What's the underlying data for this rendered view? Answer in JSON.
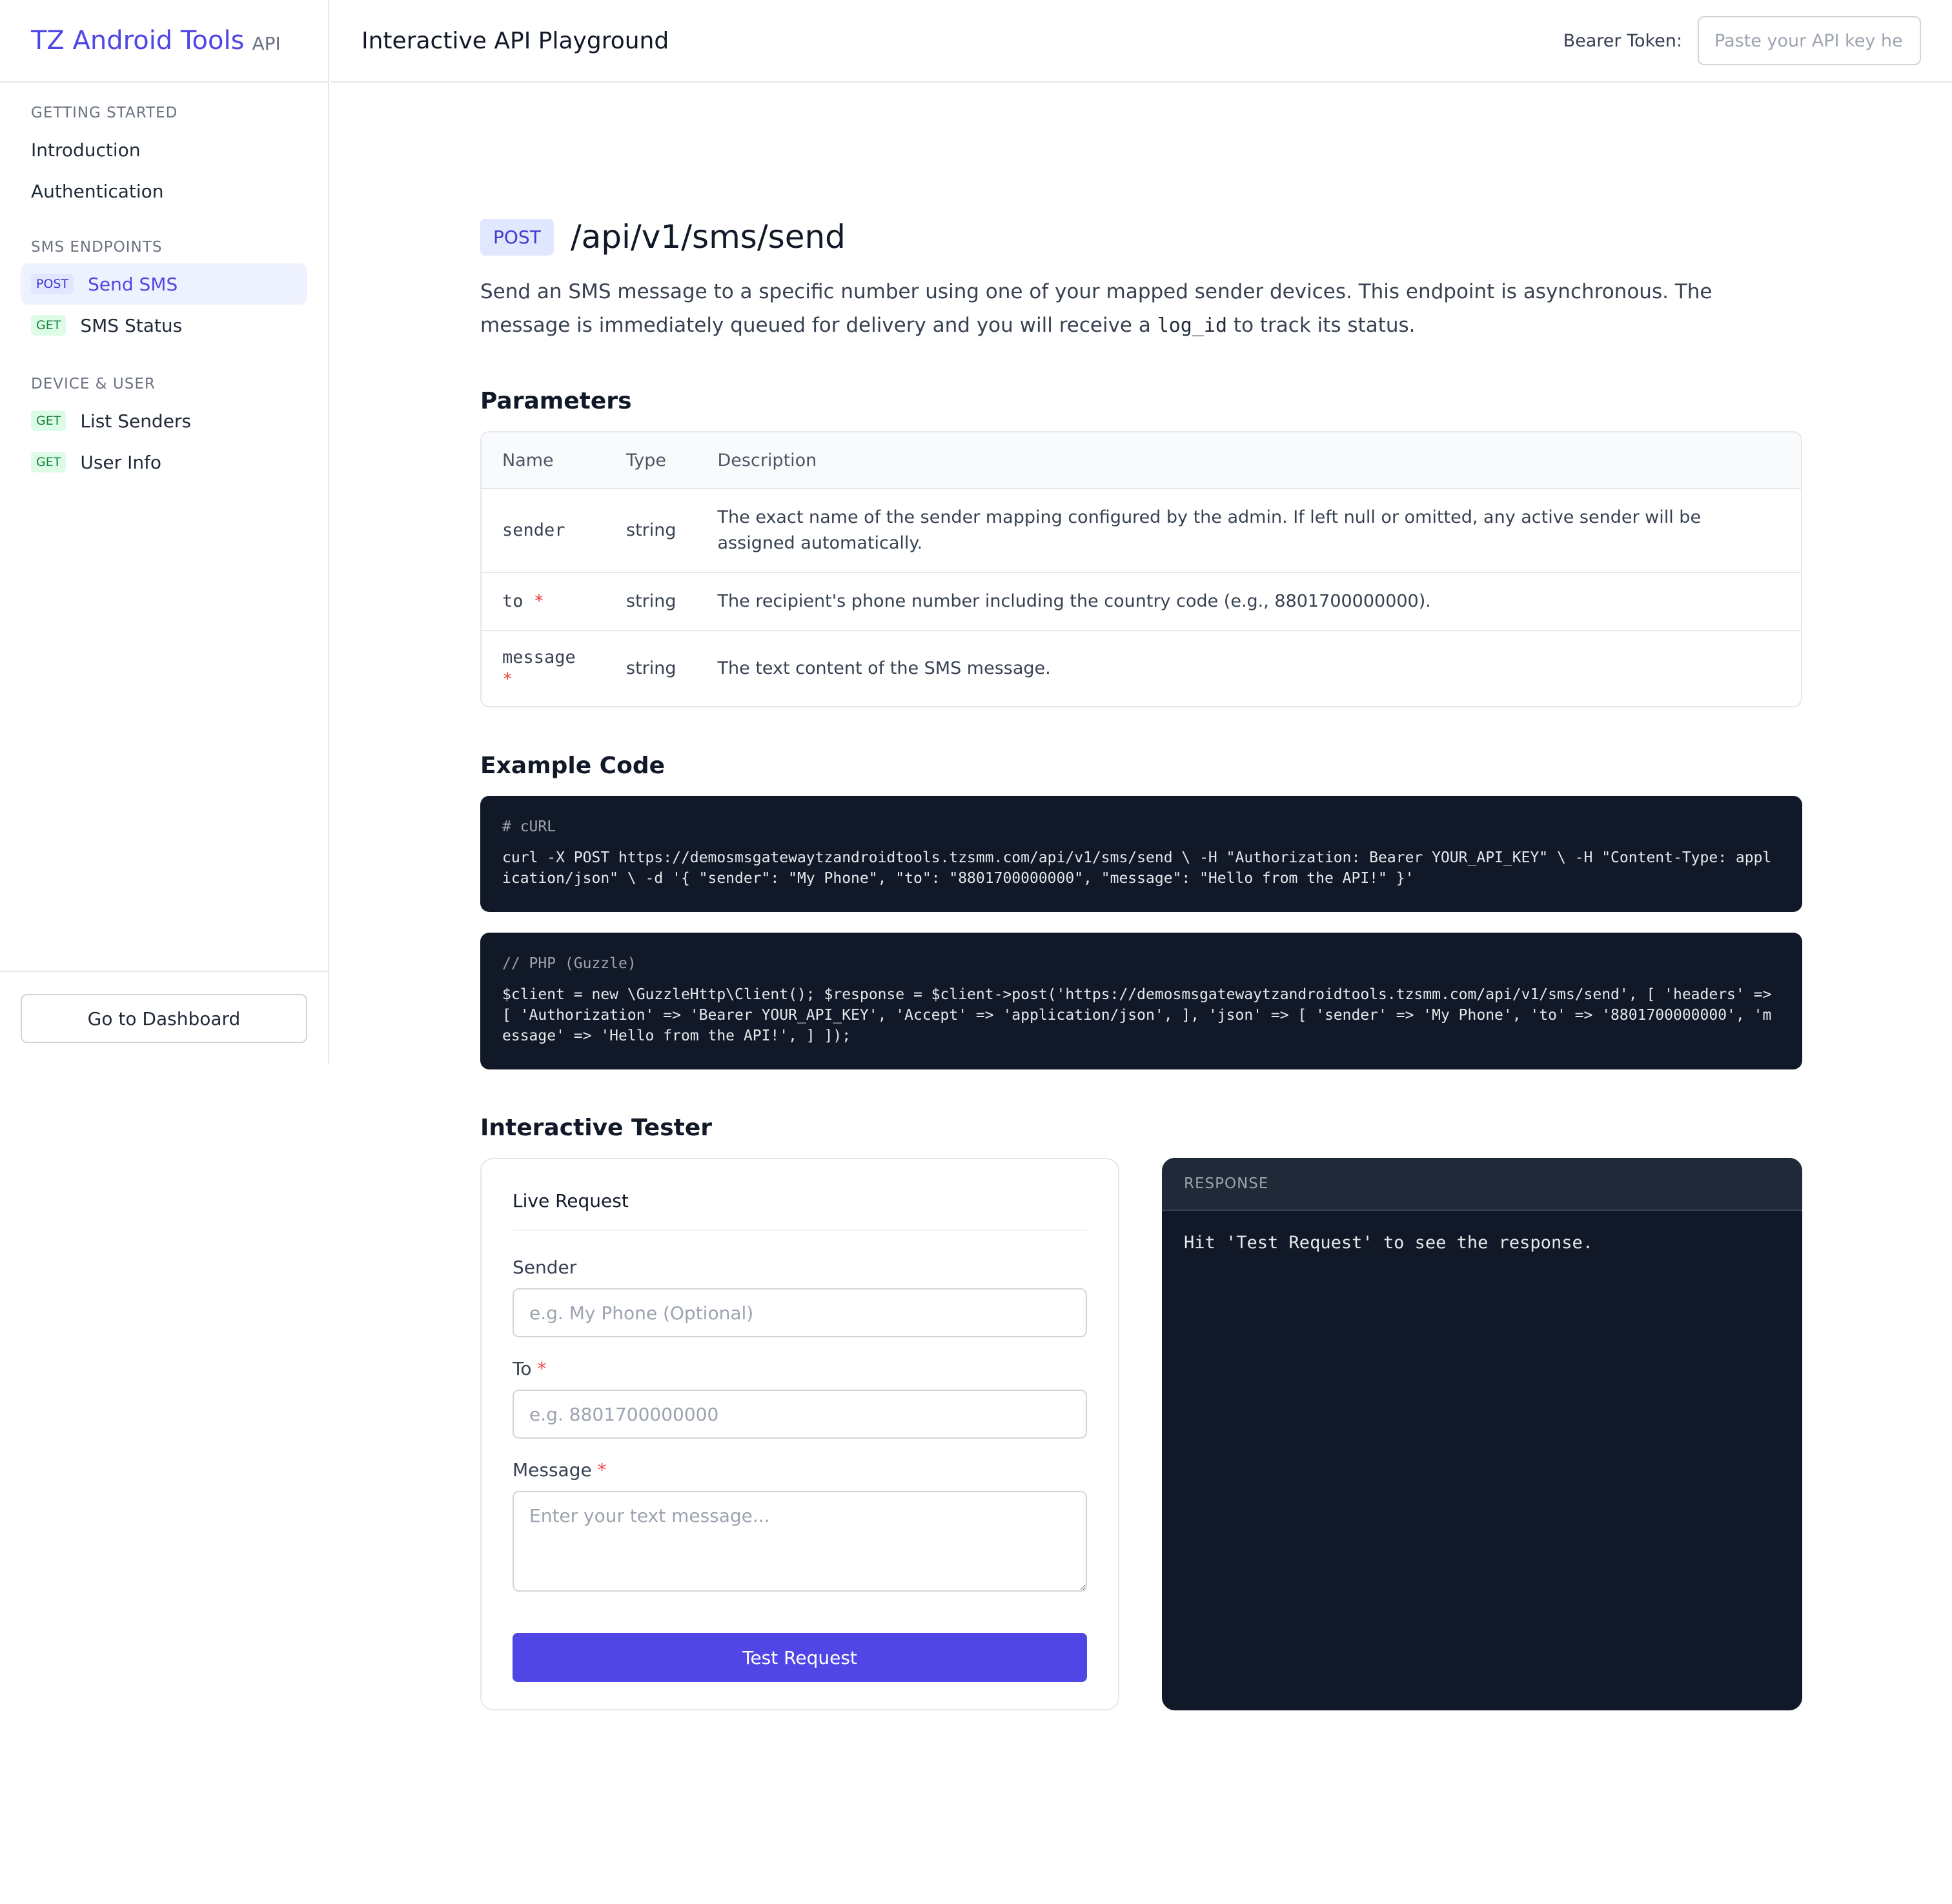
{
  "brand": {
    "name": "TZ Android Tools",
    "suffix": "API"
  },
  "header": {
    "title": "Interactive API Playground",
    "token_label": "Bearer Token:",
    "token_placeholder": "Paste your API key here"
  },
  "sidebar": {
    "sections": [
      {
        "title": "GETTING STARTED",
        "items": [
          {
            "label": "Introduction"
          },
          {
            "label": "Authentication"
          }
        ]
      },
      {
        "title": "SMS ENDPOINTS",
        "items": [
          {
            "method": "POST",
            "label": "Send SMS",
            "active": true
          },
          {
            "method": "GET",
            "label": "SMS Status"
          }
        ]
      },
      {
        "title": "DEVICE & USER",
        "items": [
          {
            "method": "GET",
            "label": "List Senders"
          },
          {
            "method": "GET",
            "label": "User Info"
          }
        ]
      }
    ],
    "dashboard_button": "Go to Dashboard"
  },
  "endpoint": {
    "method": "POST",
    "path": "/api/v1/sms/send",
    "description_before": "Send an SMS message to a specific number using one of your mapped sender devices. This endpoint is asynchronous. The message is immediately queued for delivery and you will receive a ",
    "description_code": "log_id",
    "description_after": " to track its status."
  },
  "parameters": {
    "heading": "Parameters",
    "columns": [
      "Name",
      "Type",
      "Description"
    ],
    "rows": [
      {
        "name": "sender",
        "required": false,
        "type": "string",
        "description": "The exact name of the sender mapping configured by the admin. If left null or omitted, any active sender will be assigned automatically."
      },
      {
        "name": "to",
        "required": true,
        "type": "string",
        "description": "The recipient's phone number including the country code (e.g., 8801700000000)."
      },
      {
        "name": "message",
        "required": true,
        "type": "string",
        "description": "The text content of the SMS message."
      }
    ],
    "required_mark": "*"
  },
  "examples": {
    "heading": "Example Code",
    "curl": {
      "comment": "# cURL",
      "code": "curl -X POST https://demosmsgatewaytzandroidtools.tzsmm.com/api/v1/sms/send \\ -H \"Authorization: Bearer YOUR_API_KEY\" \\ -H \"Content-Type: application/json\" \\ -d '{ \"sender\": \"My Phone\", \"to\": \"8801700000000\", \"message\": \"Hello from the API!\" }'"
    },
    "php": {
      "comment": "// PHP (Guzzle)",
      "code": "$client = new \\GuzzleHttp\\Client(); $response = $client->post('https://demosmsgatewaytzandroidtools.tzsmm.com/api/v1/sms/send', [ 'headers' => [ 'Authorization' => 'Bearer YOUR_API_KEY', 'Accept' => 'application/json', ], 'json' => [ 'sender' => 'My Phone', 'to' => '8801700000000', 'message' => 'Hello from the API!', ] ]);"
    }
  },
  "tester": {
    "heading": "Interactive Tester",
    "card_title": "Live Request",
    "fields": {
      "sender": {
        "label": "Sender",
        "placeholder": "e.g. My Phone (Optional)"
      },
      "to": {
        "label": "To",
        "placeholder": "e.g. 8801700000000"
      },
      "message": {
        "label": "Message",
        "placeholder": "Enter your text message..."
      }
    },
    "button": "Test Request",
    "response_title": "RESPONSE",
    "response_text": "Hit 'Test Request' to see the response."
  }
}
